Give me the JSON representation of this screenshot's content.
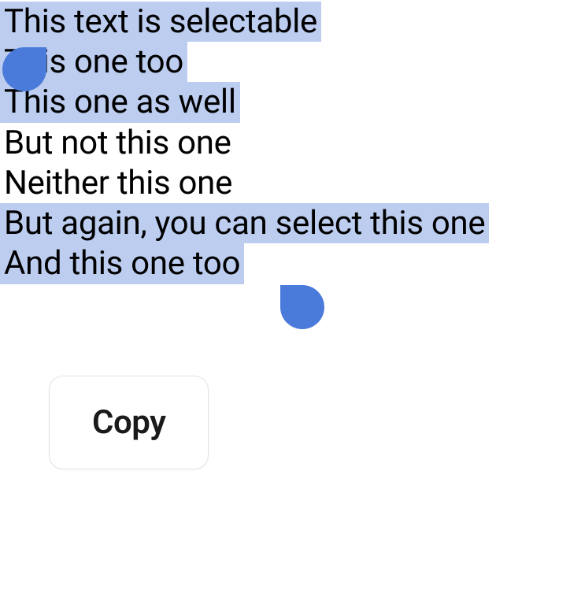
{
  "lines": {
    "line1": {
      "text": "This text is selectable",
      "selected": true
    },
    "line2": {
      "text": "This one too",
      "selected": true
    },
    "line3": {
      "text": "This one as well",
      "selected": true
    },
    "line4": {
      "text": "But not this one",
      "selected": false
    },
    "line5": {
      "text": "Neither this one",
      "selected": false
    },
    "line6": {
      "text": "But again, you can select this one",
      "selected": true
    },
    "line7": {
      "text": "And this one too",
      "selected": true
    }
  },
  "contextMenu": {
    "copyLabel": "Copy"
  },
  "colors": {
    "selectionHighlight": "#bccdf0",
    "selectionHandle": "#4b7bda"
  }
}
